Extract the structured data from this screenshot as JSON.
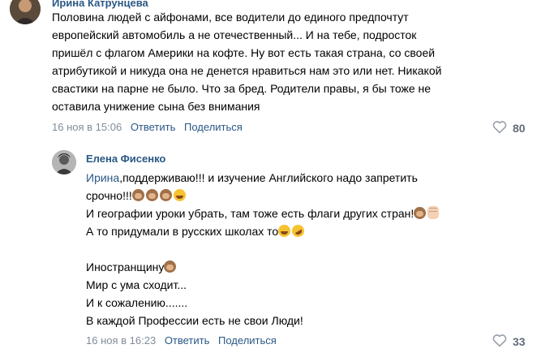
{
  "comments": [
    {
      "author": "Ирина Катрунцева",
      "lines": [
        "Половина людей с айфонами, все водители до единого предпочтут",
        "европейский автомобиль а не отечественный... И на тебе, подросток",
        "пришёл с флагом Америки на кофте. Ну вот есть такая страна, со своей",
        "атрибутикой и никуда она не денется нравиться нам это или нет. Никакой",
        "свастики на парне не было. Что за бред. Родители правы, я бы тоже не",
        "оставила унижение сына без внимания"
      ],
      "date": "16 ноя в 15:06",
      "reply_label": "Ответить",
      "share_label": "Поделиться",
      "likes": "80"
    },
    {
      "author": "Елена Фисенко",
      "mention": "Ирина",
      "line1_rest": ",поддерживаю!!! и изучение Английского надо запретить",
      "line2": "срочно!!!",
      "line3": "И географии уроки убрать, там тоже есть флаги других стран!",
      "line4": "А то придумали в русских школах то",
      "line6": "Иностранщину",
      "line7": "Мир с ума сходит...",
      "line8": "И к сожалению.......",
      "line9": "В каждой Профессии есть не свои Люди!",
      "date": "16 ноя в 16:23",
      "reply_label": "Ответить",
      "share_label": "Поделиться",
      "likes": "33"
    }
  ],
  "icons": {
    "like": "heart-icon",
    "see_no_evil": "see-no-evil-monkey-icon",
    "tears_of_joy": "face-with-tears-of-joy-icon",
    "rofl": "rolling-on-floor-laughing-icon",
    "raised_fist": "raised-fist-icon"
  },
  "colors": {
    "link": "#2a5885",
    "meta": "#818c99",
    "text": "#000000"
  }
}
